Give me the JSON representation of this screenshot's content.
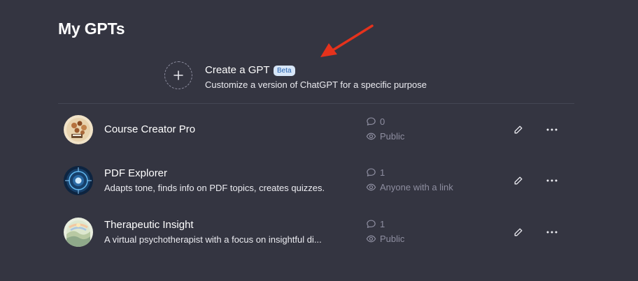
{
  "page": {
    "title": "My GPTs"
  },
  "create": {
    "title": "Create a GPT",
    "badge": "Beta",
    "subtitle": "Customize a version of ChatGPT for a specific purpose"
  },
  "gpts": [
    {
      "name": "Course Creator Pro",
      "description": "",
      "conversations": "0",
      "visibility": "Public"
    },
    {
      "name": "PDF Explorer",
      "description": "Adapts tone, finds info on PDF topics, creates quizzes.",
      "conversations": "1",
      "visibility": "Anyone with a link"
    },
    {
      "name": "Therapeutic Insight",
      "description": "A virtual psychotherapist with a focus on insightful di...",
      "conversations": "1",
      "visibility": "Public"
    }
  ],
  "colors": {
    "background": "#343541",
    "annotation_arrow": "#e5321c",
    "beta_badge_bg": "#d7e6f8",
    "beta_badge_text": "#2563b0"
  },
  "icons": {
    "create": "plus-icon",
    "conversations": "chat-bubble-icon",
    "visibility": "eye-icon",
    "edit": "pencil-icon",
    "more": "more-horizontal-icon"
  }
}
